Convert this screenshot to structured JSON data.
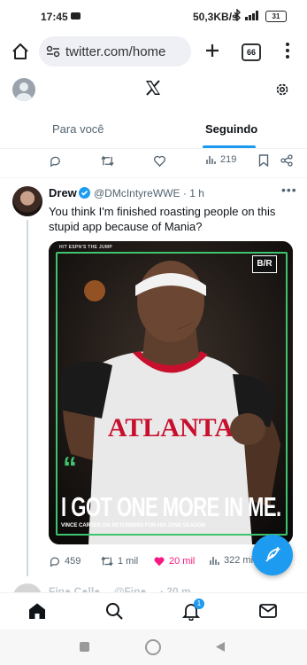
{
  "status_bar": {
    "time": "17:45",
    "network_speed": "50,3KB/s",
    "signal_label": "4G",
    "battery": "31"
  },
  "browser": {
    "url": "twitter.com/home",
    "tab_count": "66"
  },
  "header": {
    "tabs": [
      {
        "label": "Para você",
        "active": false
      },
      {
        "label": "Seguindo",
        "active": true
      }
    ]
  },
  "prev_tweet": {
    "views": "219"
  },
  "tweet": {
    "author_name": "Drew",
    "author_handle": "@DMcIntyreWWE",
    "time": "· 1 h",
    "text": "You think I'm finished roasting people on this stupid app because of Mania?",
    "media": {
      "tag": "H/T ESPN'S THE JUMP",
      "brand": "B/R",
      "headline": "I GOT ONE MORE IN ME.",
      "subline": "VINCE CARTER ON RETURNING FOR HIS 22ND SEASON",
      "jersey_text": "ATLANTA"
    },
    "stats": {
      "replies": "459",
      "retweets": "1 mil",
      "likes": "20 mil",
      "views": "322 mi"
    }
  },
  "next_tweet": {
    "preview": "Fin● C●ll●… @Fin●… · 20 m"
  },
  "colors": {
    "accent": "#1d9bf0",
    "like": "#f91880",
    "green": "#3ec46d"
  }
}
